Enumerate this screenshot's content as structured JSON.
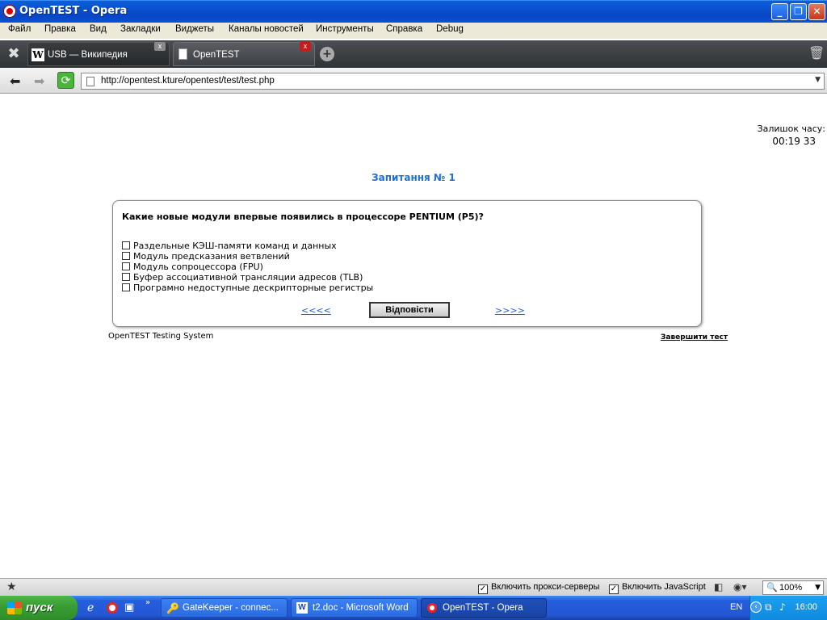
{
  "window": {
    "title": "OpenTEST - Opera"
  },
  "menu": [
    "Файл",
    "Правка",
    "Вид",
    "Закладки",
    "Виджеты",
    "Каналы новостей",
    "Инструменты",
    "Справка",
    "Debug"
  ],
  "tabs": [
    {
      "label": "USB — Википедия"
    },
    {
      "label": "OpenTEST"
    }
  ],
  "address": {
    "url": "http://opentest.kture/opentest/test/test.php"
  },
  "page": {
    "timer_label": "Залишок часу:",
    "timer_value": "00:19 33",
    "question_number": "Запитання № 1",
    "question": "Какие новые модули впервые появились в процессоре PENTIUM (P5)?",
    "options": [
      "Раздельные КЭШ-памяти команд и данных",
      "Модуль предсказания ветвлений",
      "Модуль сопроцессора (FPU)",
      "Буфер ассоциативной трансляции адресов (TLB)",
      "Програмно недоступные дескрипторные регистры"
    ],
    "prev_link": "<<<<",
    "answer_button": "Відповісти",
    "next_link": ">>>>",
    "footer": "OpenTEST Testing System",
    "finish_link": "Завершити тест"
  },
  "statusbar": {
    "proxy_label": "Включить прокси-серверы",
    "js_label": "Включить JavaScript",
    "zoom": "100%"
  },
  "taskbar": {
    "start_label": "пуск",
    "tasks": [
      "GateKeeper - connec...",
      "t2.doc - Microsoft Word",
      "OpenTEST - Opera"
    ],
    "lang": "EN",
    "clock": "16:00"
  }
}
